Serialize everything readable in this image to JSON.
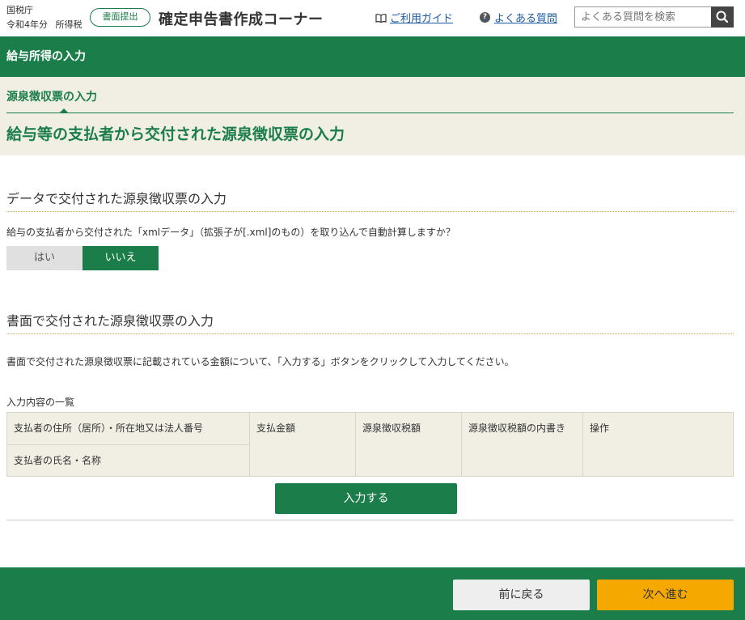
{
  "header": {
    "agency": "国税庁",
    "year": "令和4年分",
    "tax_type": "所得税",
    "submit_badge": "書面提出",
    "app_title": "確定申告書作成コーナー",
    "guide_link": "ご利用ガイド",
    "faq_link": "よくある質問",
    "search_placeholder": "よくある質問を検索"
  },
  "section": {
    "title": "給与所得の入力"
  },
  "sub": {
    "label": "源泉徴収票の入力",
    "page_title": "給与等の支払者から交付された源泉徴収票の入力"
  },
  "data_section": {
    "heading": "データで交付された源泉徴収票の入力",
    "question": "給与の支払者から交付された「xmlデータ」（拡張子が[.xml]のもの）を取り込んで自動計算しますか？",
    "yes": "はい",
    "no": "いいえ",
    "selected": "いいえ"
  },
  "paper_section": {
    "heading": "書面で交付された源泉徴収票の入力",
    "instruction": "書面で交付された源泉徴収票に記載されている金額について、「入力する」ボタンをクリックして入力してください。",
    "list_title": "入力内容の一覧",
    "columns": {
      "address": "支払者の住所（居所）・所在地又は法人番号",
      "name": "支払者の氏名・名称",
      "amount": "支払金額",
      "withholding": "源泉徴収税額",
      "withholding_detail": "源泉徴収税額の内書き",
      "operation": "操作"
    },
    "enter_button": "入力する"
  },
  "footer": {
    "back": "前に戻る",
    "next": "次へ進む"
  },
  "colors": {
    "primary_green": "#1a7d4a",
    "beige": "#f1efe4",
    "next_orange": "#f5a800",
    "link_blue": "#1c5aa6"
  }
}
